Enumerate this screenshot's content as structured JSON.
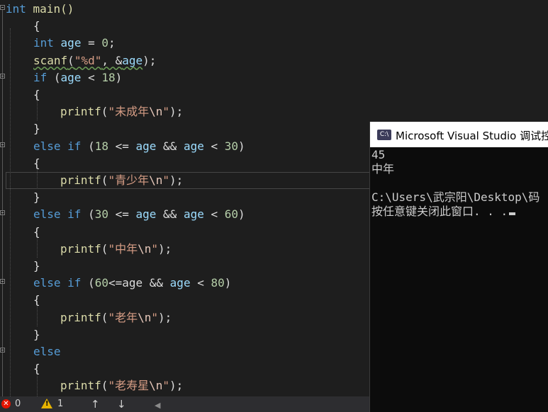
{
  "editor": {
    "lines": [
      {
        "tokens": [
          {
            "t": "int",
            "c": "kw"
          },
          {
            "t": " main()",
            "c": "fn"
          }
        ]
      },
      {
        "tokens": [
          {
            "t": "{",
            "c": "txt"
          }
        ]
      },
      {
        "tokens": [
          {
            "t": "int",
            "c": "kw"
          },
          {
            "t": " ",
            "c": "txt"
          },
          {
            "t": "age",
            "c": "id"
          },
          {
            "t": " = ",
            "c": "txt"
          },
          {
            "t": "0",
            "c": "num"
          },
          {
            "t": ";",
            "c": "txt"
          }
        ]
      },
      {
        "tokens": [
          {
            "t": "scanf",
            "c": "fn squig"
          },
          {
            "t": "(",
            "c": "txt squig"
          },
          {
            "t": "\"%d\"",
            "c": "str squig"
          },
          {
            "t": ", &",
            "c": "txt squig"
          },
          {
            "t": "age",
            "c": "id squig"
          },
          {
            "t": ");",
            "c": "txt"
          }
        ]
      },
      {
        "tokens": [
          {
            "t": "if",
            "c": "kw"
          },
          {
            "t": " (",
            "c": "txt"
          },
          {
            "t": "age",
            "c": "id"
          },
          {
            "t": " < ",
            "c": "txt"
          },
          {
            "t": "18",
            "c": "num"
          },
          {
            "t": ")",
            "c": "txt"
          }
        ]
      },
      {
        "tokens": [
          {
            "t": "{",
            "c": "txt"
          }
        ]
      },
      {
        "tokens": [
          {
            "t": "printf",
            "c": "fn"
          },
          {
            "t": "(",
            "c": "txt"
          },
          {
            "t": "\"未成年",
            "c": "str"
          },
          {
            "t": "\\n",
            "c": "esc"
          },
          {
            "t": "\"",
            "c": "str"
          },
          {
            "t": ");",
            "c": "txt"
          }
        ]
      },
      {
        "tokens": [
          {
            "t": "}",
            "c": "txt"
          }
        ]
      },
      {
        "tokens": [
          {
            "t": "else",
            "c": "kw"
          },
          {
            "t": " ",
            "c": "txt"
          },
          {
            "t": "if",
            "c": "kw"
          },
          {
            "t": " (",
            "c": "txt"
          },
          {
            "t": "18",
            "c": "num"
          },
          {
            "t": " <= ",
            "c": "txt"
          },
          {
            "t": "age",
            "c": "id"
          },
          {
            "t": " && ",
            "c": "txt"
          },
          {
            "t": "age",
            "c": "id"
          },
          {
            "t": " < ",
            "c": "txt"
          },
          {
            "t": "30",
            "c": "num"
          },
          {
            "t": ")",
            "c": "txt"
          }
        ]
      },
      {
        "tokens": [
          {
            "t": "{",
            "c": "txt"
          }
        ]
      },
      {
        "tokens": [
          {
            "t": "printf",
            "c": "fn"
          },
          {
            "t": "(",
            "c": "txt"
          },
          {
            "t": "\"青少年",
            "c": "str"
          },
          {
            "t": "\\n",
            "c": "esc"
          },
          {
            "t": "\"",
            "c": "str"
          },
          {
            "t": ");",
            "c": "txt"
          }
        ]
      },
      {
        "tokens": [
          {
            "t": "}",
            "c": "txt"
          }
        ]
      },
      {
        "tokens": [
          {
            "t": "else",
            "c": "kw"
          },
          {
            "t": " ",
            "c": "txt"
          },
          {
            "t": "if",
            "c": "kw"
          },
          {
            "t": " (",
            "c": "txt"
          },
          {
            "t": "30",
            "c": "num"
          },
          {
            "t": " <= ",
            "c": "txt"
          },
          {
            "t": "age",
            "c": "id"
          },
          {
            "t": " && ",
            "c": "txt"
          },
          {
            "t": "age",
            "c": "id"
          },
          {
            "t": " < ",
            "c": "txt"
          },
          {
            "t": "60",
            "c": "num"
          },
          {
            "t": ")",
            "c": "txt"
          }
        ]
      },
      {
        "tokens": [
          {
            "t": "{",
            "c": "txt"
          }
        ]
      },
      {
        "tokens": [
          {
            "t": "printf",
            "c": "fn"
          },
          {
            "t": "(",
            "c": "txt"
          },
          {
            "t": "\"中年",
            "c": "str"
          },
          {
            "t": "\\n",
            "c": "esc"
          },
          {
            "t": "\"",
            "c": "str"
          },
          {
            "t": ");",
            "c": "txt"
          }
        ]
      },
      {
        "tokens": [
          {
            "t": "}",
            "c": "txt"
          }
        ]
      },
      {
        "tokens": [
          {
            "t": "else",
            "c": "kw"
          },
          {
            "t": " ",
            "c": "txt"
          },
          {
            "t": "if",
            "c": "kw"
          },
          {
            "t": " (",
            "c": "txt"
          },
          {
            "t": "60",
            "c": "num"
          },
          {
            "t": "<=age && ",
            "c": "txt"
          },
          {
            "t": "age",
            "c": "id"
          },
          {
            "t": " < ",
            "c": "txt"
          },
          {
            "t": "80",
            "c": "num"
          },
          {
            "t": ")",
            "c": "txt"
          }
        ]
      },
      {
        "tokens": [
          {
            "t": "{",
            "c": "txt"
          }
        ]
      },
      {
        "tokens": [
          {
            "t": "printf",
            "c": "fn"
          },
          {
            "t": "(",
            "c": "txt"
          },
          {
            "t": "\"老年",
            "c": "str"
          },
          {
            "t": "\\n",
            "c": "esc"
          },
          {
            "t": "\"",
            "c": "str"
          },
          {
            "t": ");",
            "c": "txt"
          }
        ]
      },
      {
        "tokens": [
          {
            "t": "}",
            "c": "txt"
          }
        ]
      },
      {
        "tokens": [
          {
            "t": "else",
            "c": "kw"
          }
        ]
      },
      {
        "tokens": [
          {
            "t": "{",
            "c": "txt"
          }
        ]
      },
      {
        "tokens": [
          {
            "t": "printf",
            "c": "fn"
          },
          {
            "t": "(",
            "c": "txt"
          },
          {
            "t": "\"老寿星",
            "c": "str"
          },
          {
            "t": "\\n",
            "c": "esc"
          },
          {
            "t": "\"",
            "c": "str"
          },
          {
            "t": ");",
            "c": "txt"
          }
        ]
      }
    ]
  },
  "statusbar": {
    "errors": "0",
    "warnings": "1",
    "nav_up": "↑",
    "nav_down": "↓",
    "scroll_left": "◀"
  },
  "console": {
    "icon_label": "C:\\",
    "title": "Microsoft Visual Studio 调试控",
    "output": [
      "45",
      "中年",
      "",
      "C:\\Users\\武宗阳\\Desktop\\码",
      "按任意键关闭此窗口. . ."
    ]
  },
  "colors": {
    "editor_bg": "#1e1e1e",
    "keyword": "#569cd6",
    "function": "#dcdcaa",
    "identifier": "#9cdcfe",
    "number": "#b5cea8",
    "string": "#d69d85",
    "console_bg": "#0c0c0c"
  }
}
